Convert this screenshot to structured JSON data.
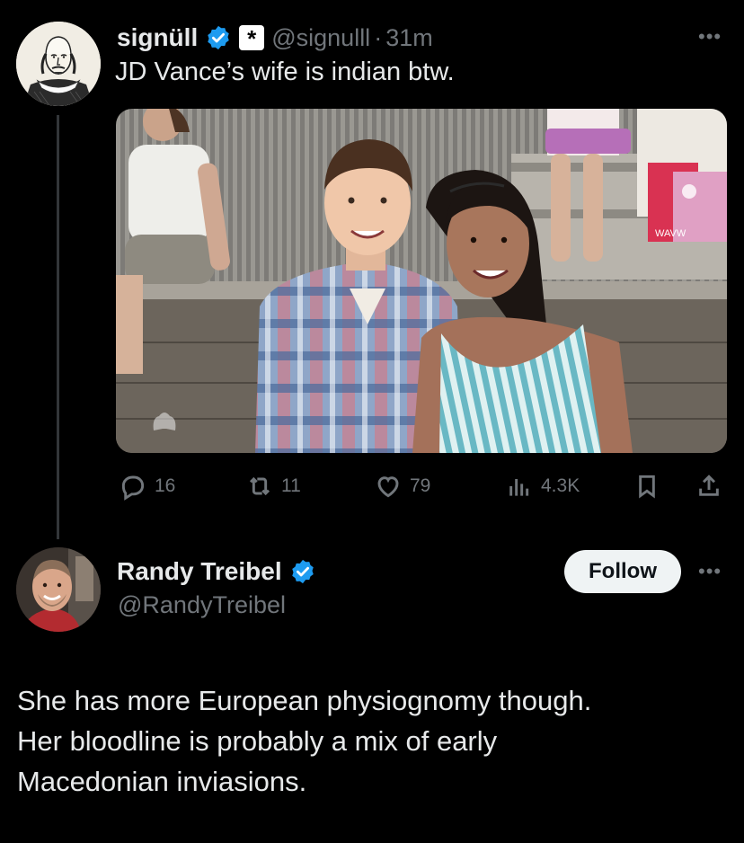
{
  "tweet": {
    "author_name": "signüll",
    "author_handle": "@signulll",
    "separator": "·",
    "time_ago": "31m",
    "text": "JD Vance’s wife is indian btw.",
    "affiliate_badge": "*",
    "media_watermark": "NBC peacock logo",
    "bag_print": "WAVW",
    "stats": {
      "replies": "16",
      "reposts": "11",
      "likes": "79",
      "views": "4.3K"
    }
  },
  "reply": {
    "author_name": "Randy Treibel",
    "author_handle": "@RandyTreibel",
    "follow_label": "Follow",
    "text_lines": [
      "She has more European physiognomy though.",
      "Her bloodline is probably a mix of early",
      "Macedonian inviasions."
    ]
  },
  "icons": {
    "verified": "verified-badge-icon",
    "more": "more-options-icon",
    "reply": "reply-icon",
    "repost": "repost-icon",
    "like": "like-heart-icon",
    "views": "views-chart-icon",
    "bookmark": "bookmark-icon",
    "share": "share-icon"
  },
  "colors": {
    "background": "#000000",
    "text_primary": "#e7e9ea",
    "text_secondary": "#71767b",
    "verified_blue": "#1d9bf0",
    "thread_line": "#333639",
    "follow_bg": "#eff3f4"
  }
}
